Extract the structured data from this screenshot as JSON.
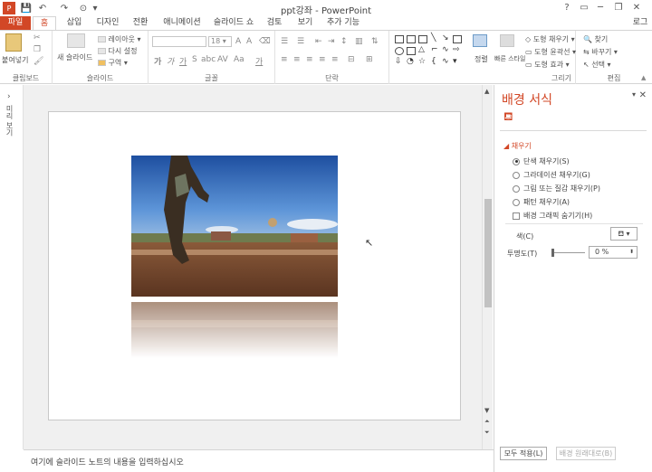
{
  "window": {
    "title": "ppt강좌 - PowerPoint",
    "help_label": "?",
    "minimize_label": "─",
    "restore_label": "❐",
    "close_label": "✕",
    "signin_label": "로그"
  },
  "quick_access": {
    "save": "💾",
    "undo": "↶",
    "redo": "↷",
    "customize": "▾"
  },
  "tabs": [
    "파일",
    "홈",
    "삽입",
    "디자인",
    "전환",
    "애니메이션",
    "슬라이드 쇼",
    "검토",
    "보기",
    "추가 기능"
  ],
  "ribbon": {
    "clipboard": {
      "label": "클립보드",
      "paste": "붙여넣기"
    },
    "slides": {
      "label": "슬라이드",
      "new_slide": "새 슬라이드",
      "layout": "레이아웃",
      "reset": "다시 설정",
      "section": "구역"
    },
    "font": {
      "label": "글꼴",
      "size": "18"
    },
    "paragraph": {
      "label": "단락"
    },
    "drawing": {
      "label": "그리기",
      "arrange": "정렬",
      "quick_styles": "빠른 스타일",
      "fill": "도형 채우기",
      "outline": "도형 윤곽선",
      "effects": "도형 효과"
    },
    "editing": {
      "label": "편집",
      "find": "찾기",
      "replace": "바꾸기",
      "select": "선택"
    }
  },
  "left_pane": {
    "label": "미리 보기"
  },
  "format_pane": {
    "title": "배경 서식",
    "section": "채우기",
    "options": [
      {
        "label": "단색 채우기(S)",
        "selected": true
      },
      {
        "label": "그라데이션 채우기(G)",
        "selected": false
      },
      {
        "label": "그림 또는 질감 채우기(P)",
        "selected": false
      },
      {
        "label": "패턴 채우기(A)",
        "selected": false
      }
    ],
    "hide_graphics": "배경 그래픽 숨기기(H)",
    "color_label": "색(C)",
    "transparency_label": "투명도(T)",
    "transparency_value": "0 %",
    "apply_all": "모두 적용(L)",
    "reset_bg": "배경 원래대로(B)"
  },
  "notes": {
    "placeholder": "여기에 슬라이드 노트의 내용을 입력하십시오"
  }
}
